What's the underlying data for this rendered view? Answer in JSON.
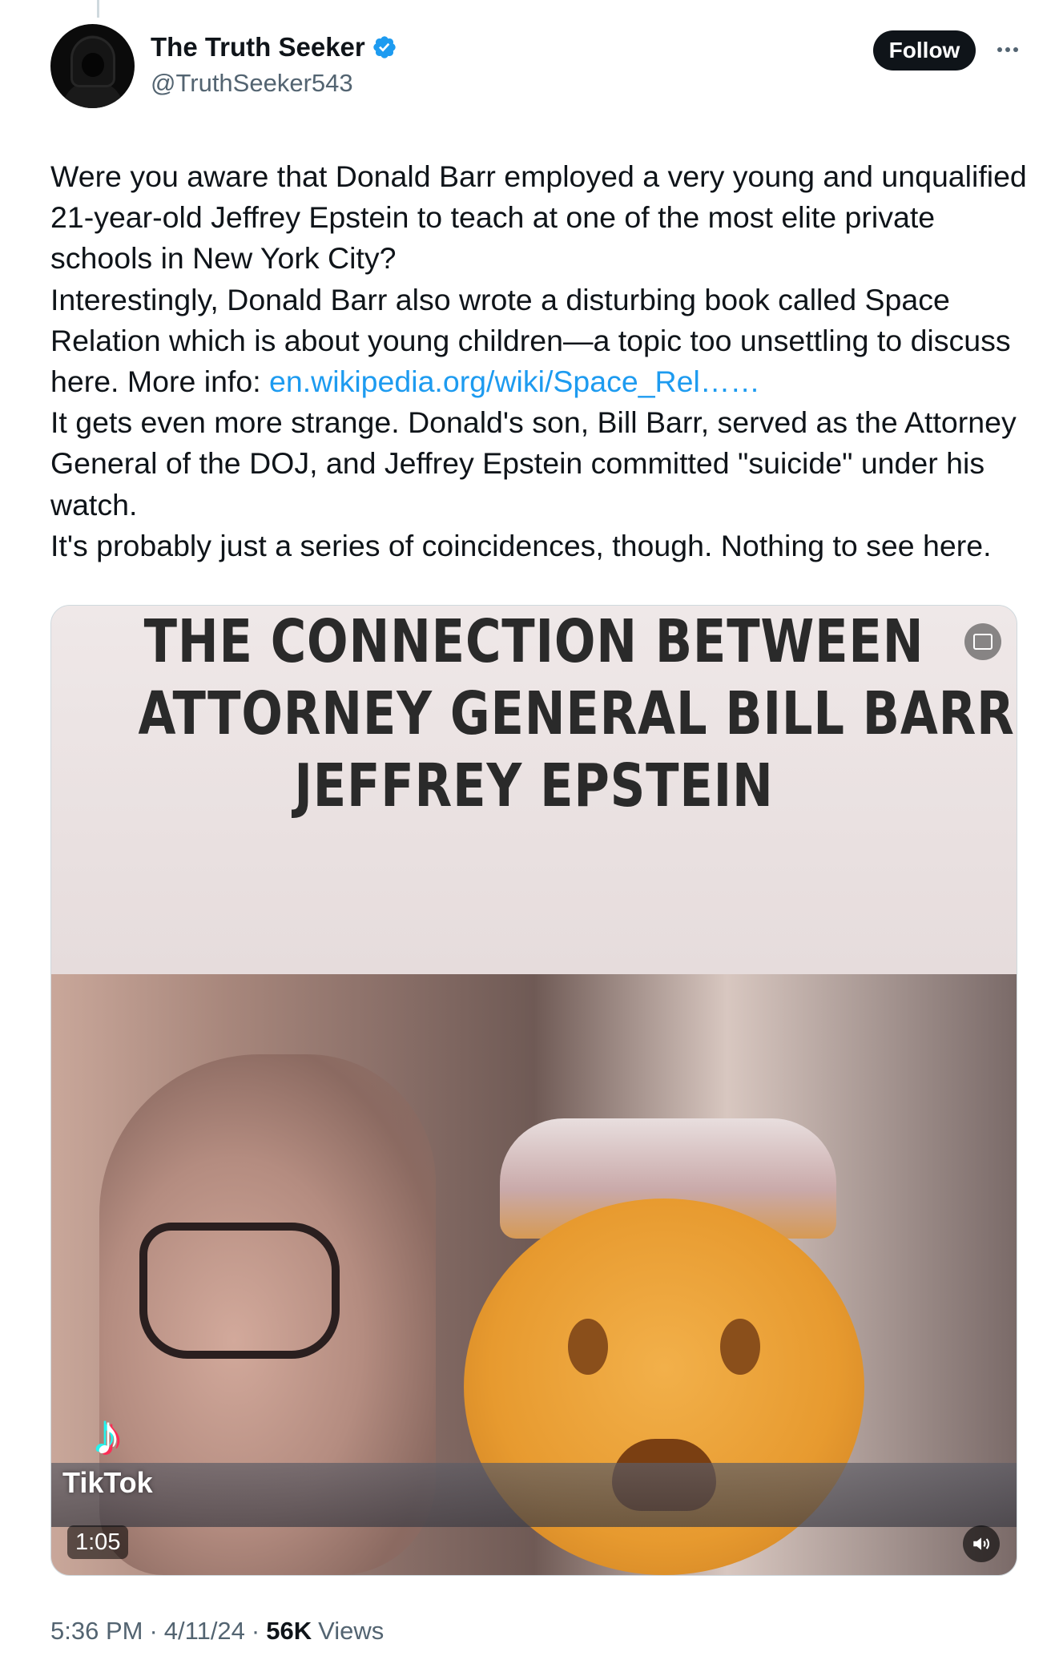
{
  "author": {
    "display_name": "The Truth Seeker",
    "handle": "@TruthSeeker543",
    "verified": true,
    "verified_color": "#1d9bf0"
  },
  "actions": {
    "follow_label": "Follow"
  },
  "tweet": {
    "paragraphs": [
      {
        "text": "Were you aware that Donald Barr employed a very young and unqualified 21-year-old Jeffrey Epstein to teach at one of the most elite private schools in New York City?"
      },
      {
        "text": "Interestingly, Donald Barr also wrote a disturbing book called Space Relation which is about young children—a topic too unsettling to discuss here. More info: ",
        "link": "en.wikipedia.org/wiki/Space_Rel",
        "suffix": "……"
      },
      {
        "text": "It gets even more strange. Donald's son, Bill Barr, served as the Attorney General of the DOJ, and Jeffrey Epstein committed \"suicide\" under his watch."
      },
      {
        "text": "It's probably just a series of coincidences, though. Nothing to see here."
      }
    ]
  },
  "media": {
    "caption_lines": [
      "THE CONNECTION BETWEEN",
      "ATTORNEY GENERAL BILL BARR &",
      "JEFFREY EPSTEIN"
    ],
    "watermark": "TikTok",
    "duration": "1:05",
    "gif_icon": "captions-icon",
    "volume_icon": "volume-icon"
  },
  "meta": {
    "time": "5:36 PM",
    "separator": "·",
    "date": "4/11/24",
    "views_count": "56K",
    "views_label": "Views"
  },
  "colors": {
    "text_primary": "#0f1419",
    "text_secondary": "#536471",
    "link": "#1d9bf0",
    "follow_bg": "#0f1419"
  }
}
